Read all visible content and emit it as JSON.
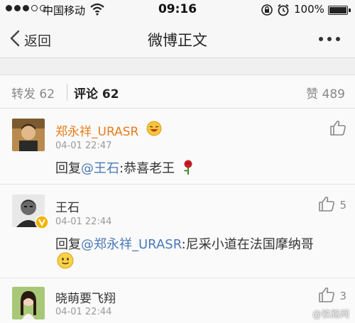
{
  "status_bar": {
    "carrier": "中国移动",
    "time": "09:16",
    "battery": "100%"
  },
  "nav": {
    "back_label": "返回",
    "title": "微博正文"
  },
  "tabs": {
    "repost": "转发 62",
    "comment": "评论 62",
    "like": "赞 489"
  },
  "comments": [
    {
      "user": "郑永祥_URASR",
      "time": "04-01 22:47",
      "reply_prefix": "回复",
      "mention": "@王石",
      "text": ":恭喜老王",
      "like_count": ""
    },
    {
      "user": "王石",
      "time": "04-01 22:44",
      "reply_prefix": "回复",
      "mention": "@郑永祥_URASR",
      "text": ":尼采小道在法国摩纳哥",
      "like_count": "5"
    },
    {
      "user": "晓萌要飞翔",
      "time": "04-01 22:44",
      "like_count": "3"
    }
  ],
  "watermark": "@铁路网"
}
